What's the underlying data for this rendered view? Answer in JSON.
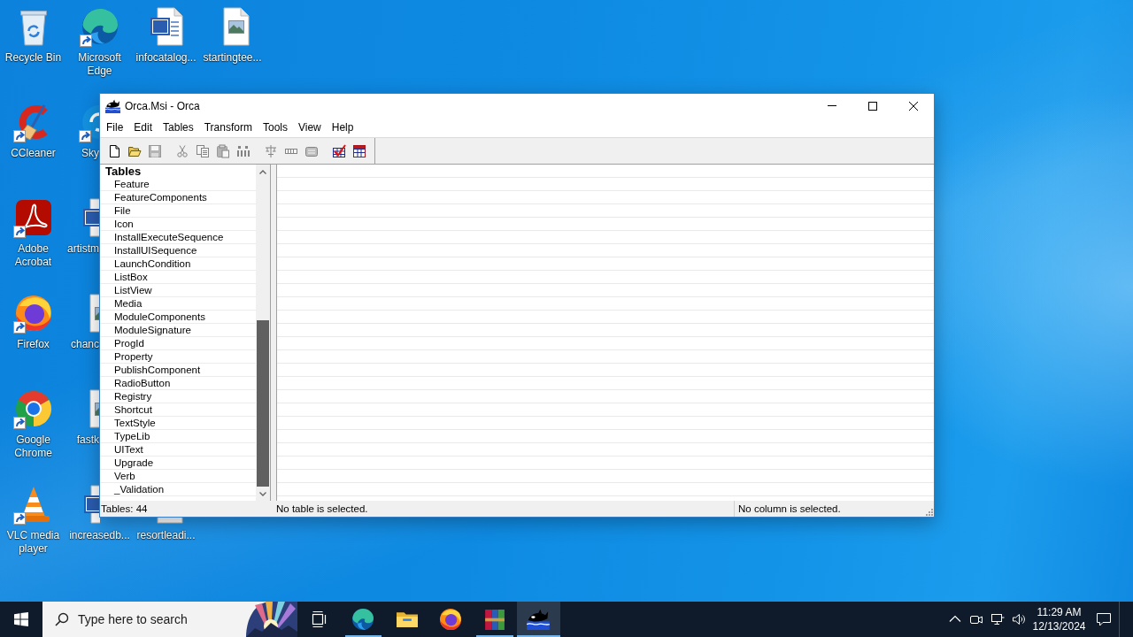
{
  "desktop": {
    "icon_row_top": [
      {
        "label": "Recycle Bin",
        "kind": "recycle-bin",
        "shortcut": false
      },
      {
        "label": "Microsoft Edge",
        "kind": "edge",
        "shortcut": true
      },
      {
        "label": "infocatalog...",
        "kind": "word-doc",
        "shortcut": false
      },
      {
        "label": "startingtee...",
        "kind": "image-file",
        "shortcut": false
      }
    ],
    "icon_rows_left": [
      [
        {
          "label": "CCleaner",
          "kind": "ccleaner",
          "shortcut": true
        },
        {
          "label": "Sky",
          "kind": "skype",
          "shortcut": true
        }
      ],
      [
        {
          "label": "Adobe Acrobat",
          "kind": "acrobat",
          "shortcut": true
        },
        {
          "label": "artistm",
          "kind": "word-doc",
          "shortcut": false
        }
      ],
      [
        {
          "label": "Firefox",
          "kind": "firefox",
          "shortcut": true
        },
        {
          "label": "chanc",
          "kind": "image-file",
          "shortcut": false
        }
      ],
      [
        {
          "label": "Google Chrome",
          "kind": "chrome",
          "shortcut": true
        },
        {
          "label": "fastk",
          "kind": "image-file",
          "shortcut": false
        }
      ]
    ],
    "icon_row_bottom": [
      {
        "label": "VLC media player",
        "kind": "vlc",
        "shortcut": true
      },
      {
        "label": "increasedb...",
        "kind": "word-doc",
        "shortcut": false
      },
      {
        "label": "resortleadi...",
        "kind": "image-file",
        "shortcut": false
      }
    ]
  },
  "window": {
    "title": "Orca.Msi - Orca",
    "menu": [
      "File",
      "Edit",
      "Tables",
      "Transform",
      "Tools",
      "View",
      "Help"
    ],
    "toolbar": [
      [
        {
          "kind": "new",
          "disabled": false
        },
        {
          "kind": "open",
          "disabled": false
        },
        {
          "kind": "save",
          "disabled": true
        }
      ],
      [
        {
          "kind": "cut",
          "disabled": true
        },
        {
          "kind": "copy",
          "disabled": true
        },
        {
          "kind": "paste",
          "disabled": true
        },
        {
          "kind": "find",
          "disabled": true
        }
      ],
      [
        {
          "kind": "tree",
          "disabled": true
        },
        {
          "kind": "row",
          "disabled": true
        },
        {
          "kind": "box",
          "disabled": true
        }
      ],
      [
        {
          "kind": "grid-check",
          "disabled": false
        },
        {
          "kind": "grid",
          "disabled": false
        }
      ]
    ],
    "table_list": {
      "header": "Tables",
      "items": [
        {
          "name": "Feature",
          "selected": false
        },
        {
          "name": "FeatureComponents",
          "selected": false
        },
        {
          "name": "File",
          "selected": false
        },
        {
          "name": "Icon",
          "selected": false
        },
        {
          "name": "InstallExecuteSequence",
          "selected": false
        },
        {
          "name": "InstallUISequence",
          "selected": false
        },
        {
          "name": "LaunchCondition",
          "selected": false
        },
        {
          "name": "ListBox",
          "selected": false
        },
        {
          "name": "ListView",
          "selected": false
        },
        {
          "name": "Media",
          "selected": false
        },
        {
          "name": "ModuleComponents",
          "selected": false
        },
        {
          "name": "ModuleSignature",
          "selected": false
        },
        {
          "name": "ProgId",
          "selected": false
        },
        {
          "name": "Property",
          "selected": false
        },
        {
          "name": "PublishComponent",
          "selected": false
        },
        {
          "name": "RadioButton",
          "selected": false
        },
        {
          "name": "Registry",
          "selected": false
        },
        {
          "name": "Shortcut",
          "selected": false
        },
        {
          "name": "TextStyle",
          "selected": false
        },
        {
          "name": "TypeLib",
          "selected": false
        },
        {
          "name": "UIText",
          "selected": false
        },
        {
          "name": "Upgrade",
          "selected": false
        },
        {
          "name": "Verb",
          "selected": false
        },
        {
          "name": "_Validation",
          "selected": false
        }
      ]
    },
    "status_bar": [
      "Tables: 44",
      "No table is selected.",
      "No column is selected."
    ]
  },
  "taskbar": {
    "search": {
      "placeholder": "Type here to search"
    },
    "buttons": [
      {
        "kind": "task-view",
        "running": false,
        "selected": false
      },
      {
        "kind": "edge",
        "running": true,
        "selected": false
      },
      {
        "kind": "explorer",
        "running": false,
        "selected": false
      },
      {
        "kind": "firefox",
        "running": false,
        "selected": false
      },
      {
        "kind": "winrar",
        "running": true,
        "selected": false
      },
      {
        "kind": "orca",
        "running": true,
        "selected": true
      }
    ],
    "tray_icons": [
      {
        "kind": "chevron"
      },
      {
        "kind": "meet-now"
      },
      {
        "kind": "network"
      },
      {
        "kind": "volume"
      }
    ],
    "clock": {
      "time": "11:29 AM",
      "date": "12/13/2024"
    }
  }
}
